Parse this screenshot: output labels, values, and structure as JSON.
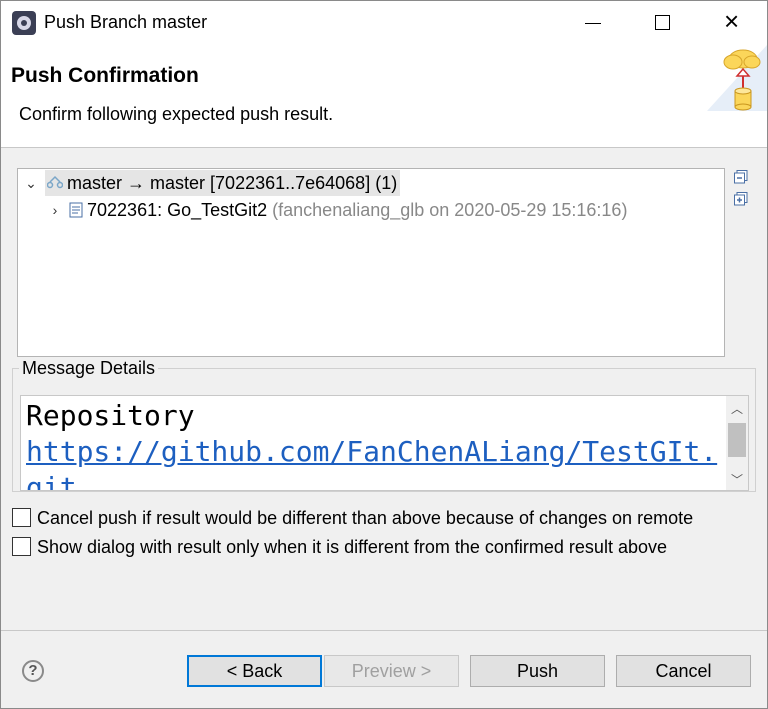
{
  "window": {
    "title": "Push Branch master"
  },
  "header": {
    "title": "Push Confirmation",
    "subtitle": "Confirm following expected push result.",
    "image_icon": "cloud-upload-database-icon"
  },
  "tree": {
    "ref_row": {
      "label": "master → master [7022361..7e64068] (1)",
      "icon": "branch-sync-icon",
      "expanded": true
    },
    "commit_row": {
      "label": "7022361: Go_TestGit2",
      "detail": "(fanchenaliang_glb on 2020-05-29 15:16:16)",
      "icon": "commit-icon",
      "expanded": false
    },
    "side_buttons": [
      "collapse-all-icon",
      "expand-all-icon"
    ]
  },
  "message_details": {
    "label": "Message Details",
    "heading": "Repository",
    "link": "https://github.com/FanChenALiang/TestGIt.git"
  },
  "options": [
    {
      "label": "Cancel push if result would be different than above because of changes on remote",
      "checked": false
    },
    {
      "label": "Show dialog with result only when it is different from the confirmed result above",
      "checked": false
    }
  ],
  "footer": {
    "help": "?",
    "back": "< Back",
    "preview": "Preview >",
    "push": "Push",
    "cancel": "Cancel"
  }
}
